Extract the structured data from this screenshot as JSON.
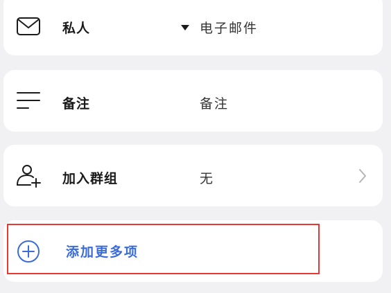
{
  "email_row": {
    "label": "私人",
    "value": "电子邮件"
  },
  "notes_row": {
    "label": "备注",
    "placeholder": "备注"
  },
  "group_row": {
    "label": "加入群组",
    "value": "无"
  },
  "add_more": {
    "label": "添加更多项"
  },
  "colors": {
    "background": "#f1f1f3",
    "card": "#ffffff",
    "accent": "#3a6bd8",
    "highlight": "#e53935"
  }
}
